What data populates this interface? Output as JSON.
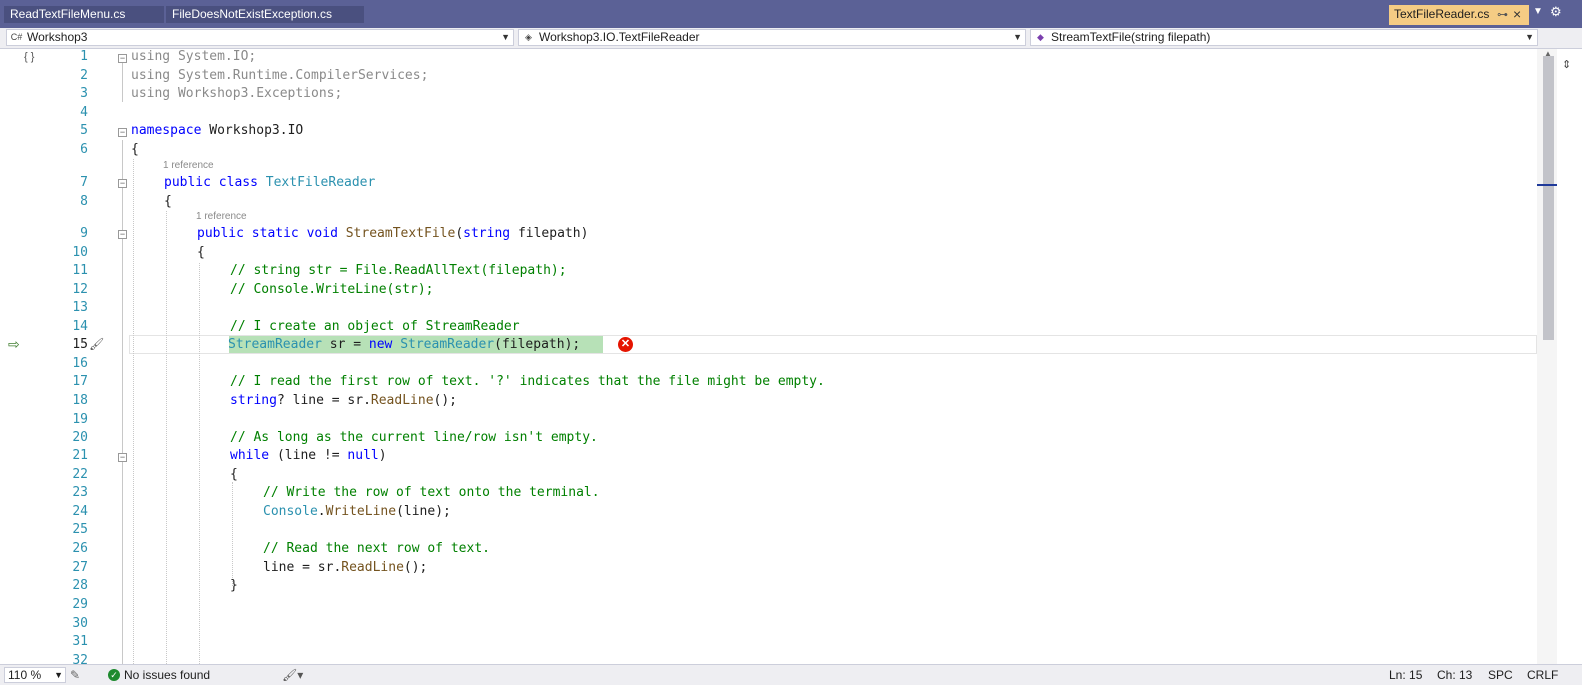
{
  "tabs": [
    {
      "label": "ReadTextFileMenu.cs"
    },
    {
      "label": "FileDoesNotExistException.cs"
    }
  ],
  "active_tab": {
    "label": "TextFileReader.cs",
    "pin_icon": "pin-icon",
    "close_icon": "close-icon"
  },
  "navbar": {
    "project": "Workshop3",
    "type": "Workshop3.IO.TextFileReader",
    "member": "StreamTextFile(string filepath)"
  },
  "editor": {
    "current_line": 15,
    "lines": [
      {
        "n": "1",
        "html": "using System.IO;"
      },
      {
        "n": "2",
        "html": "using System.Runtime.CompilerServices;"
      },
      {
        "n": "3",
        "html": "using Workshop3.Exceptions;"
      },
      {
        "n": "4",
        "html": ""
      },
      {
        "n": "5",
        "html": "namespace Workshop3.IO"
      },
      {
        "n": "6",
        "html": "{"
      },
      {
        "n": "7",
        "html": "public class TextFileReader"
      },
      {
        "n": "8",
        "html": "{"
      },
      {
        "n": "9",
        "html": "public static void StreamTextFile(string filepath)"
      },
      {
        "n": "10",
        "html": "{"
      },
      {
        "n": "11",
        "html": "// string str = File.ReadAllText(filepath);"
      },
      {
        "n": "12",
        "html": "// Console.WriteLine(str);"
      },
      {
        "n": "13",
        "html": ""
      },
      {
        "n": "14",
        "html": "// I create an object of StreamReader"
      },
      {
        "n": "15",
        "html": "StreamReader sr = new StreamReader(filepath);"
      },
      {
        "n": "16",
        "html": ""
      },
      {
        "n": "17",
        "html": "// I read the first row of text. '?' indicates that the file might be empty."
      },
      {
        "n": "18",
        "html": "string? line = sr.ReadLine();"
      },
      {
        "n": "19",
        "html": ""
      },
      {
        "n": "20",
        "html": "// As long as the current line/row isn't empty."
      },
      {
        "n": "21",
        "html": "while (line != null)"
      },
      {
        "n": "22",
        "html": "{"
      },
      {
        "n": "23",
        "html": "// Write the row of text onto the terminal."
      },
      {
        "n": "24",
        "html": "Console.WriteLine(line);"
      },
      {
        "n": "25",
        "html": ""
      },
      {
        "n": "26",
        "html": "// Read the next row of text."
      },
      {
        "n": "27",
        "html": "line = sr.ReadLine();"
      },
      {
        "n": "28",
        "html": "}"
      },
      {
        "n": "29",
        "html": ""
      },
      {
        "n": "30",
        "html": ""
      },
      {
        "n": "31",
        "html": ""
      },
      {
        "n": "32",
        "html": ""
      }
    ],
    "codelens_class": "1 reference",
    "codelens_method": "1 reference"
  },
  "status": {
    "zoom": "110 %",
    "issues": "No issues found",
    "ln": "Ln: 15",
    "ch": "Ch: 13",
    "spc": "SPC",
    "crlf": "CRLF"
  },
  "colors": {
    "tab_bar": "#5b6196",
    "active_tab": "#f5cc84",
    "exec_highlight": "#b7e1b7",
    "error": "#e51400"
  }
}
